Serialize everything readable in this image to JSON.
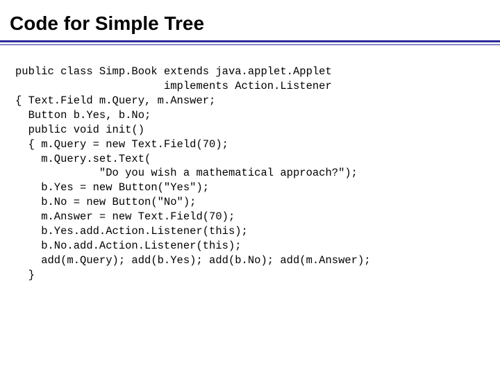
{
  "title": "Code for Simple Tree",
  "code_lines": [
    "public class Simp.Book extends java.applet.Applet",
    "                       implements Action.Listener",
    "{ Text.Field m.Query, m.Answer;",
    "  Button b.Yes, b.No;",
    "  public void init()",
    "  { m.Query = new Text.Field(70);",
    "    m.Query.set.Text(",
    "             \"Do you wish a mathematical approach?\");",
    "    b.Yes = new Button(\"Yes\");",
    "    b.No = new Button(\"No\");",
    "    m.Answer = new Text.Field(70);",
    "    b.Yes.add.Action.Listener(this);",
    "    b.No.add.Action.Listener(this);",
    "    add(m.Query); add(b.Yes); add(b.No); add(m.Answer);",
    "  }"
  ]
}
